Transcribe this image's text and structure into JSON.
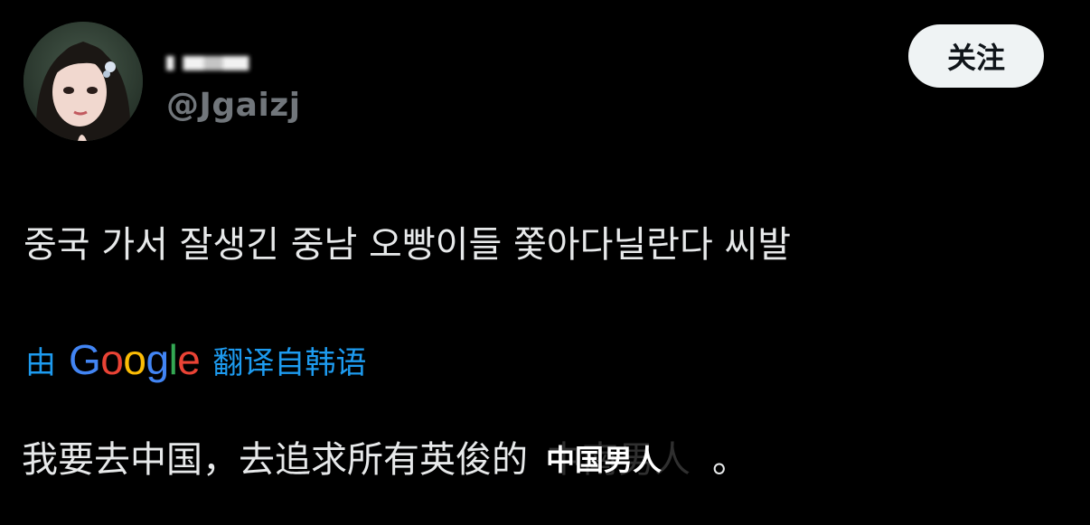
{
  "tweet": {
    "display_name_redacted": "",
    "handle": "@Jgaizj",
    "follow_label": "关注",
    "text": "중국 가서 잘생긴 중남 오빵이들 쫓아다닐란다 씨발",
    "translation_prefix": "由",
    "translation_provider_letters": [
      "G",
      "o",
      "o",
      "g",
      "l",
      "e"
    ],
    "translation_provider_colors": [
      "#4285F4",
      "#EA4335",
      "#FBBC05",
      "#4285F4",
      "#34A853",
      "#EA4335"
    ],
    "translation_suffix": "翻译自韩语",
    "translated_before": "我要去中国，去追求所有英俊的",
    "translated_covered": "中南男人",
    "translated_overlay": "中国男人",
    "translated_after": "。"
  },
  "colors": {
    "background": "#000000",
    "text": "#e7e9ea",
    "secondary": "#71767b",
    "link": "#1d9bf0",
    "button_bg": "#eff3f4",
    "button_text": "#0f1419"
  }
}
